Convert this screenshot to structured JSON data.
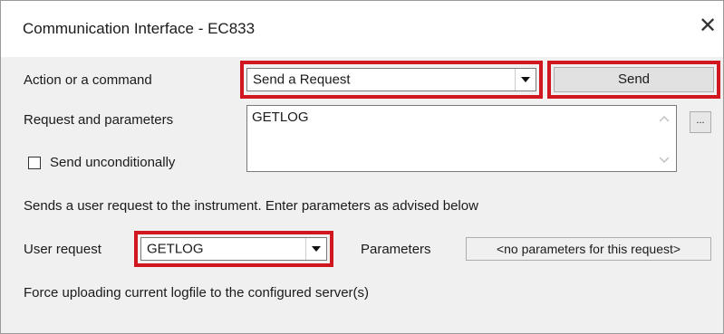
{
  "window": {
    "title": "Communication Interface - EC833",
    "close_glyph": "✕"
  },
  "action": {
    "label": "Action or a command",
    "selected": "Send a Request"
  },
  "send_button": {
    "label": "Send"
  },
  "request": {
    "label": "Request and parameters",
    "value": "GETLOG",
    "browse_label": "..."
  },
  "send_unconditionally": {
    "label": "Send unconditionally",
    "checked": false
  },
  "description": "Sends a user request to the instrument. Enter parameters as advised below",
  "user_request": {
    "label": "User request",
    "selected": "GETLOG"
  },
  "parameters": {
    "label": "Parameters",
    "value": "<no parameters for this request>"
  },
  "help_text": "Force uploading current logfile to the configured server(s)",
  "colors": {
    "highlight": "#d0161f",
    "dialog_bg": "#f0f0f0"
  }
}
